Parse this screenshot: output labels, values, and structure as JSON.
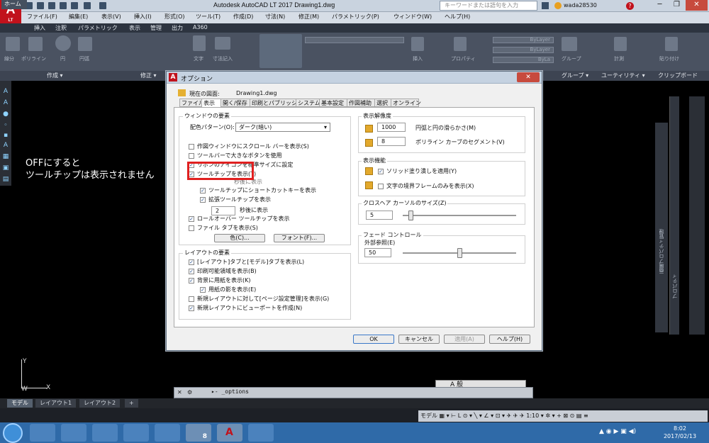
{
  "app": {
    "logo": "A",
    "logo_sub": "LT",
    "title": "Autodesk AutoCAD LT 2017    Drawing1.dwg",
    "search_placeholder": "キーワードまたは語句を入力",
    "user": "wada28530"
  },
  "menu": [
    "ファイル(F)",
    "編集(E)",
    "表示(V)",
    "挿入(I)",
    "形式(O)",
    "ツール(T)",
    "作成(D)",
    "寸法(N)",
    "修正(M)",
    "パラメトリック(P)",
    "ウィンドウ(W)",
    "ヘルプ(H)"
  ],
  "ribbon_tabs": [
    "ホーム",
    "挿入",
    "注釈",
    "パラメトリック",
    "表示",
    "管理",
    "出力",
    "A360"
  ],
  "ribbon_panels": [
    "作成 ▾",
    "修正 ▾",
    "グループ ▾",
    "ユーティリティ ▾",
    "クリップボード"
  ],
  "ribbon_labels": [
    "線分",
    "ポリライン",
    "円",
    "円弧",
    "文字",
    "寸法記入",
    "挿入",
    "プロパティ",
    "グループ",
    "計測",
    "貼り付け"
  ],
  "ribbon_bylayer": [
    "ByLayer",
    "ByLayer",
    "ByLa"
  ],
  "annotation": [
    "OFFにすると",
    "ツールチップは表示されません"
  ],
  "palettes": [
    "画層プロパティ管理",
    "プロパティ"
  ],
  "command_line": "▸- _options",
  "ime_bar": "A 般",
  "layout_tabs": [
    "モデル",
    "レイアウト1",
    "レイアウト2",
    "+"
  ],
  "status_bar": "モデル ▦ ▾ ⊢ L ⊙ ▾ ╲ ▾ ∠ ▾ ⊡ ▾ ✈ ✈ ✈ 1:10 ▾ ✲ ▾ + ⊠ ⊙ ▤ ≡",
  "taskbar": {
    "time": "8:02",
    "date": "2017/02/13",
    "psp_badge": "8"
  },
  "dialog": {
    "title": "オプション",
    "current_drawing_label": "現在の図面:",
    "current_drawing": "Drawing1.dwg",
    "tabs": [
      "ファイル",
      "表示",
      "開く/保存",
      "印刷とパブリッシュ",
      "システム",
      "基本設定",
      "作図補助",
      "選択",
      "オンライン"
    ],
    "active_tab": "表示",
    "window_group": {
      "title": "ウィンドウの要素",
      "color_scheme_label": "配色パターン(O):",
      "color_scheme_value": "ダーク(暗い)",
      "options": [
        {
          "label": "作図ウィンドウにスクロール バーを表示(S)",
          "checked": false
        },
        {
          "label": "ツールバーで大きなボタンを使用",
          "checked": false
        },
        {
          "label": "リボンのアイコンを標準サイズに設定",
          "checked": true
        },
        {
          "label": "ツールチップを表示(T)",
          "checked": true
        },
        {
          "label": "秒後に表示",
          "checked": false
        },
        {
          "label": "ツールチップにショートカットキーを表示",
          "checked": true
        },
        {
          "label": "拡張ツールチップを表示",
          "checked": true
        },
        {
          "label": "秒後に表示",
          "checked": false
        },
        {
          "label": "ロールオーバー ツールチップを表示",
          "checked": true
        },
        {
          "label": "ファイル タブを表示(S)",
          "checked": false
        }
      ],
      "delay_value": "2",
      "color_button": "色(C)...",
      "font_button": "フォント(F)..."
    },
    "layout_group": {
      "title": "レイアウトの要素",
      "options": [
        {
          "label": "[レイアウト]タブと[モデル]タブを表示(L)",
          "checked": true
        },
        {
          "label": "印刷可能領域を表示(B)",
          "checked": true
        },
        {
          "label": "背景に用紙を表示(K)",
          "checked": true
        },
        {
          "label": "用紙の影を表示(E)",
          "checked": true
        },
        {
          "label": "新規レイアウトに対して[ページ設定管理]を表示(G)",
          "checked": false
        },
        {
          "label": "新規レイアウトにビューポートを作成(N)",
          "checked": true
        }
      ]
    },
    "resolution_group": {
      "title": "表示解像度",
      "items": [
        {
          "value": "1000",
          "label": "円弧と円の滑らかさ(M)"
        },
        {
          "value": "8",
          "label": "ポリライン カーブのセグメント(V)"
        }
      ]
    },
    "performance_group": {
      "title": "表示機能",
      "options": [
        {
          "label": "ソリッド塗り潰しを適用(Y)",
          "checked": true
        },
        {
          "label": "文字の境界フレームのみを表示(X)",
          "checked": false
        }
      ]
    },
    "crosshair_group": {
      "title": "クロスヘア カーソルのサイズ(Z)",
      "value": "5",
      "level_percent": 5
    },
    "fade_group": {
      "title": "フェード コントロール",
      "xref_label": "外部参照(E)",
      "value": "50",
      "level_percent": 50
    },
    "buttons": {
      "ok": "OK",
      "cancel": "キャンセル",
      "apply": "適用(A)",
      "help": "ヘルプ(H)"
    }
  }
}
